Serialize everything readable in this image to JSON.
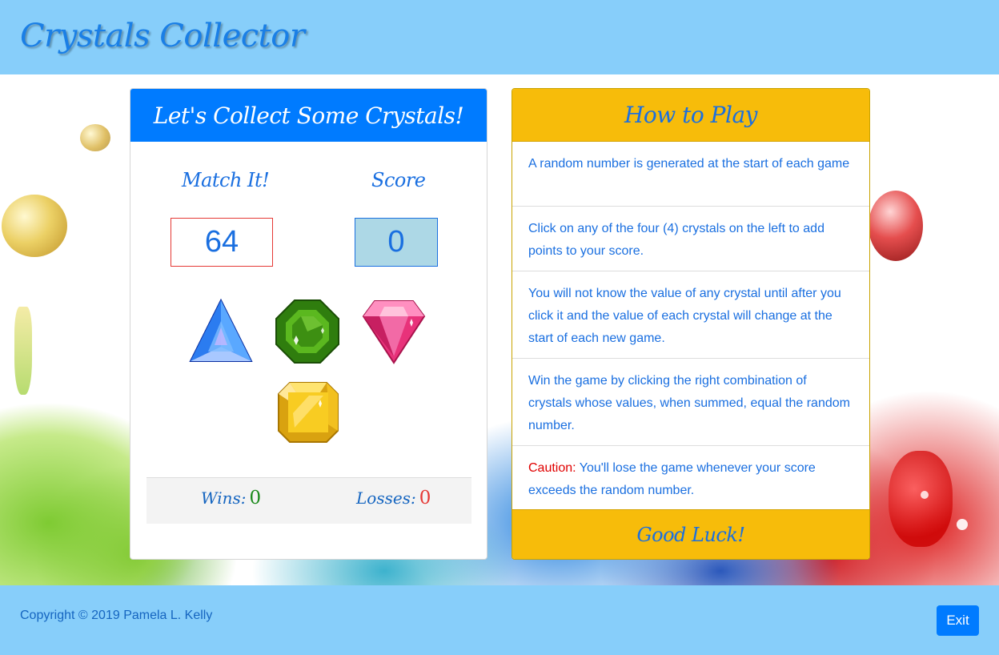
{
  "header": {
    "title": "Crystals Collector"
  },
  "game": {
    "card_title": "Let's Collect Some Crystals!",
    "match_label": "Match It!",
    "score_label": "Score",
    "target_number": "64",
    "score_value": "0",
    "crystals": [
      {
        "name": "blue-crystal",
        "color": "#1e6fe8"
      },
      {
        "name": "green-crystal",
        "color": "#3a9b14"
      },
      {
        "name": "pink-crystal",
        "color": "#e8327a"
      },
      {
        "name": "yellow-crystal",
        "color": "#f4c21a"
      }
    ],
    "wins_label": "Wins:",
    "wins_value": "0",
    "losses_label": "Losses:",
    "losses_value": "0"
  },
  "instructions": {
    "title": "How to Play",
    "steps": [
      "A random number is generated at the start of each game",
      "Click on any of the four (4) crystals on the left to add points to your score.",
      "You will not know the value of any crystal until after you click it and the value of each crystal will change at the start of each new game.",
      "Win the game by clicking the right combination of crystals whose values, when summed, equal the random number."
    ],
    "caution_label": "Caution:",
    "caution_text": "You'll lose the game whenever your score exceeds the random number.",
    "footer": "Good Luck!"
  },
  "footer": {
    "copyright": "Copyright © 2019 Pamela L. Kelly",
    "exit_label": "Exit"
  },
  "colors": {
    "header_bg": "#87cefa",
    "primary": "#007bff",
    "warning": "#f7bc0a",
    "win": "#1b8a1b",
    "loss": "#e53935"
  }
}
